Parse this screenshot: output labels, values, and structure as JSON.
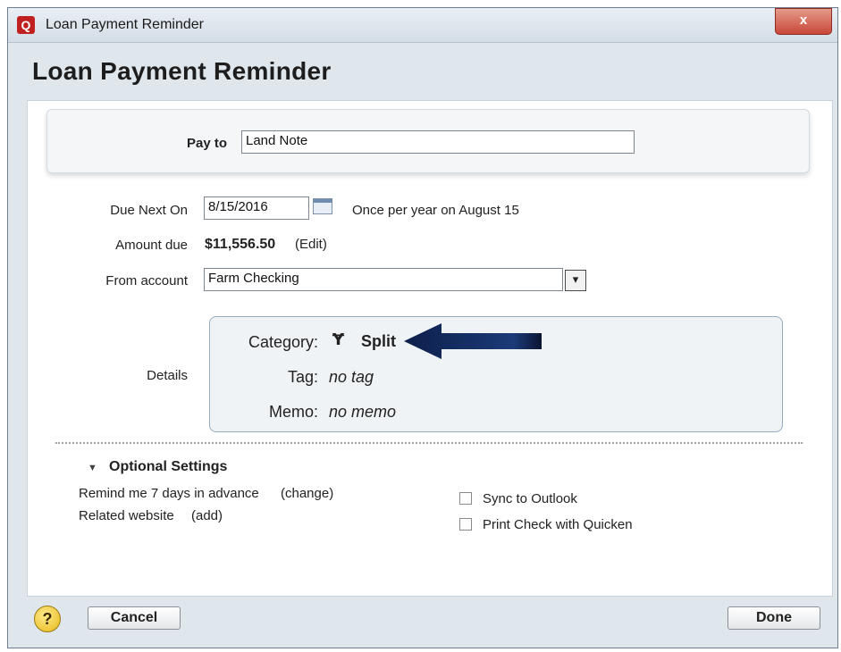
{
  "window": {
    "title": "Loan Payment Reminder",
    "app_icon_letter": "Q",
    "close_label": "x"
  },
  "heading": "Loan Payment Reminder",
  "payto": {
    "label": "Pay to",
    "value": "Land Note"
  },
  "due": {
    "label": "Due Next On",
    "value": "8/15/2016",
    "recurrence": "Once per year on August 15"
  },
  "amount": {
    "label": "Amount due",
    "value": "$11,556.50",
    "edit_link": "(Edit)"
  },
  "account": {
    "label": "From account",
    "value": "Farm Checking",
    "dropdown_glyph": "▾"
  },
  "details": {
    "label": "Details",
    "category_label": "Category:",
    "category_icon_glyph": "Ɏ",
    "category_value": "Split",
    "tag_label": "Tag:",
    "tag_value": "no tag",
    "memo_label": "Memo:",
    "memo_value": "no memo"
  },
  "optional": {
    "title": "Optional Settings",
    "remind_text": "Remind me 7 days in advance",
    "remind_link": "(change)",
    "website_text": "Related website",
    "website_link": "(add)",
    "sync_label": "Sync to Outlook",
    "sync_checked": false,
    "print_label": "Print Check with Quicken",
    "print_checked": false
  },
  "footer": {
    "help_glyph": "?",
    "cancel_label": "Cancel",
    "done_label": "Done"
  },
  "colors": {
    "link": "#2a55c8",
    "arrow": "#0d1f4a",
    "close": "#c9463a"
  },
  "icons": [
    "app-logo-icon",
    "close-icon",
    "calendar-icon",
    "dropdown-arrow-icon",
    "split-icon",
    "annotation-arrow",
    "collapse-triangle-icon",
    "help-icon"
  ]
}
